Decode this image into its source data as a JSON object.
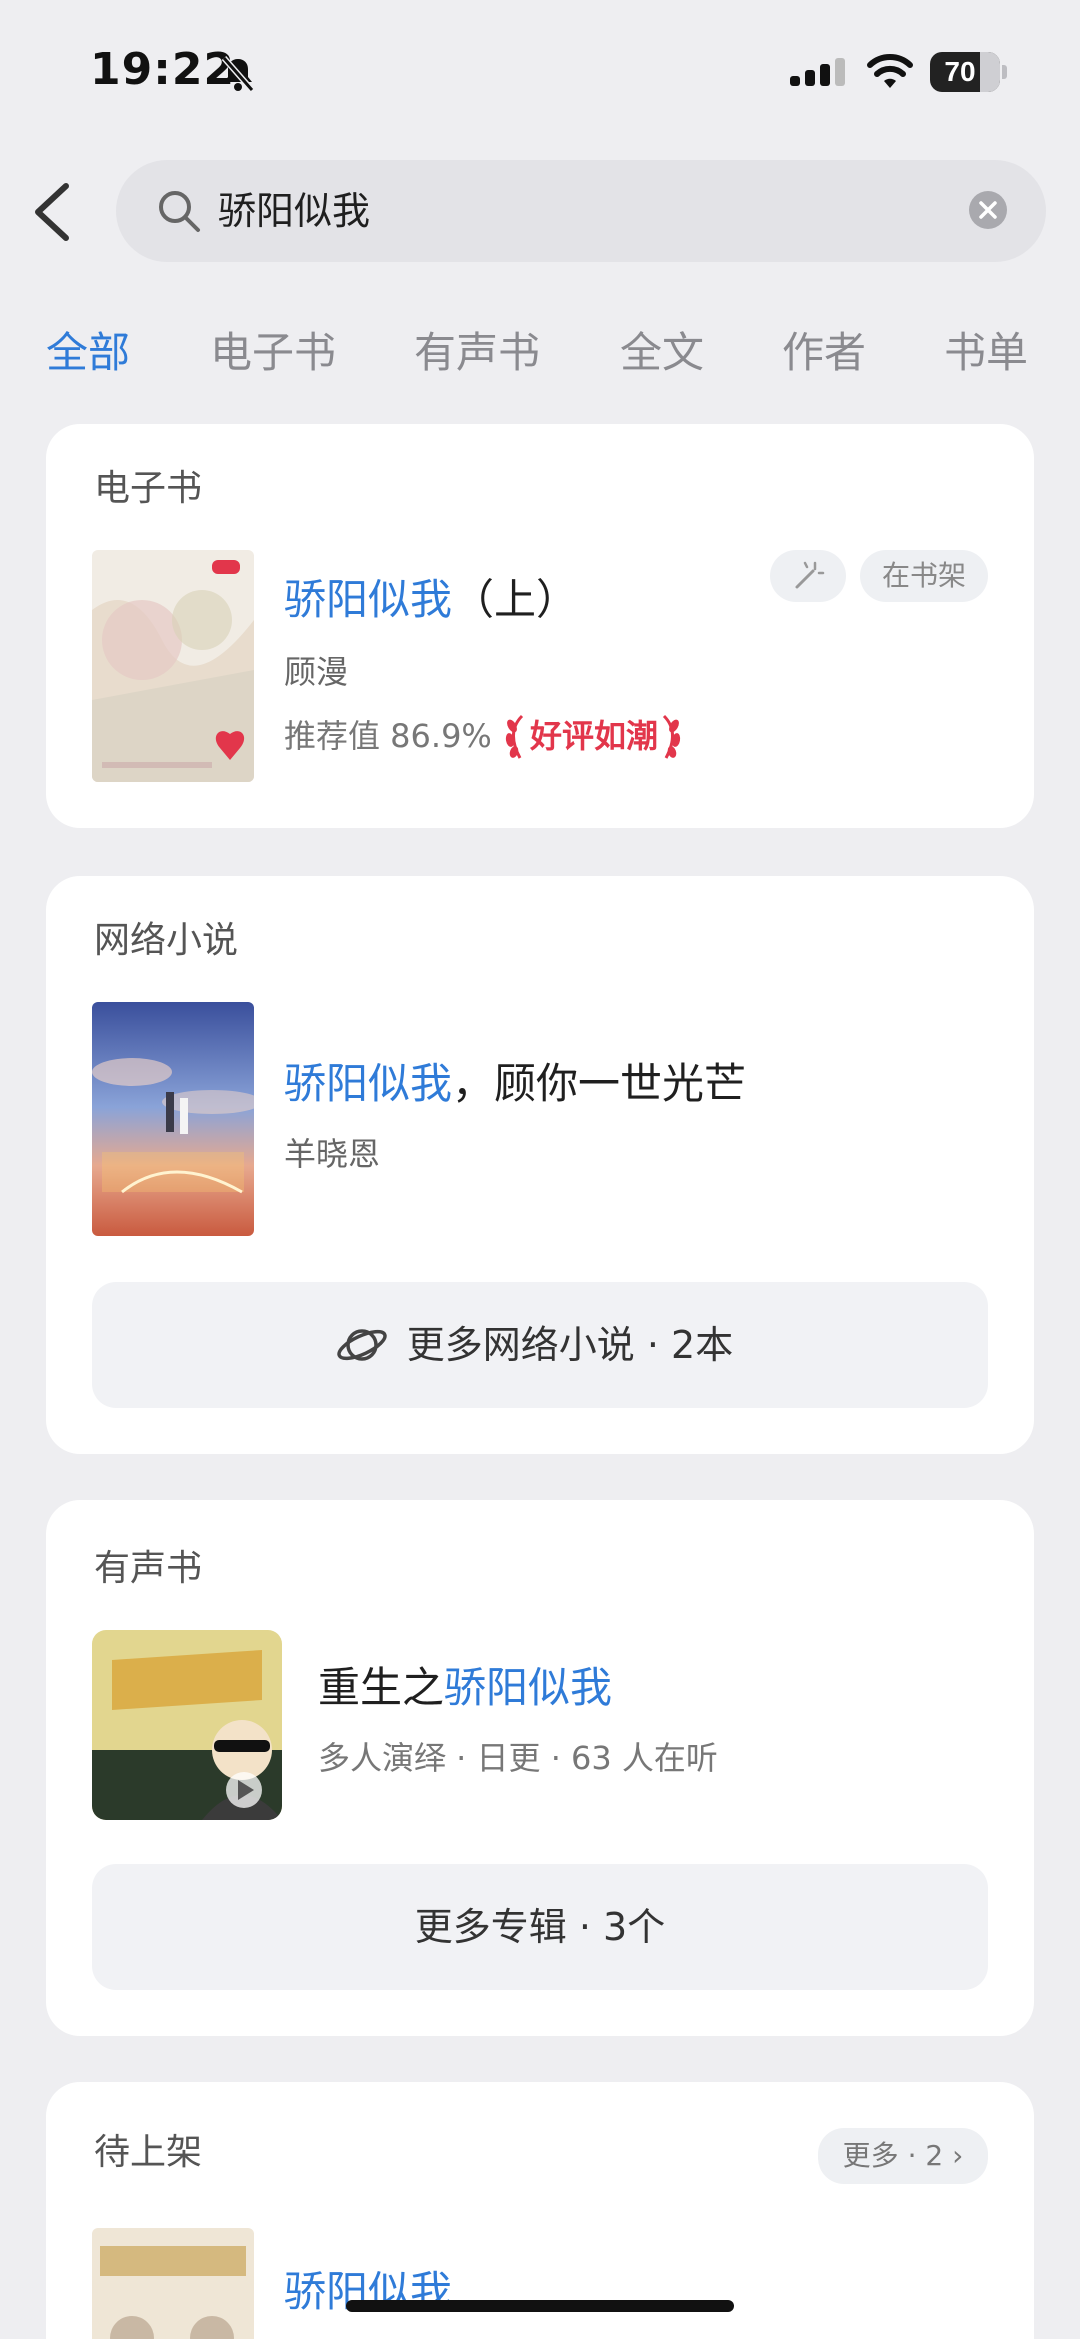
{
  "status": {
    "time": "19:22",
    "battery": "70",
    "battery_level": 0.7
  },
  "search": {
    "query": "骄阳似我"
  },
  "tabs": [
    "全部",
    "电子书",
    "有声书",
    "全文",
    "作者",
    "书单"
  ],
  "ebook": {
    "section_title": "电子书",
    "title_hl": "骄阳似我",
    "title_rest": "（上）",
    "author": "顾漫",
    "recommend": "推荐值 86.9%",
    "badge": "好评如潮",
    "shelf_label": "在书架"
  },
  "webnovel": {
    "section_title": "网络小说",
    "title_hl": "骄阳似我",
    "title_rest": "，顾你一世光芒",
    "author": "羊晓恩",
    "more_label": "更多网络小说 · 2本"
  },
  "audiobook": {
    "section_title": "有声书",
    "title_pre": "重生之",
    "title_hl": "骄阳似我",
    "meta": "多人演绎 · 日更 · 63 人在听",
    "more_label": "更多专辑 · 3个"
  },
  "pending": {
    "section_title": "待上架",
    "more_label": "更多 · 2",
    "title_hl": "骄阳似我"
  },
  "colors": {
    "accent": "#2f7bd8",
    "badge": "#e2364b",
    "background": "#eeeef1"
  }
}
